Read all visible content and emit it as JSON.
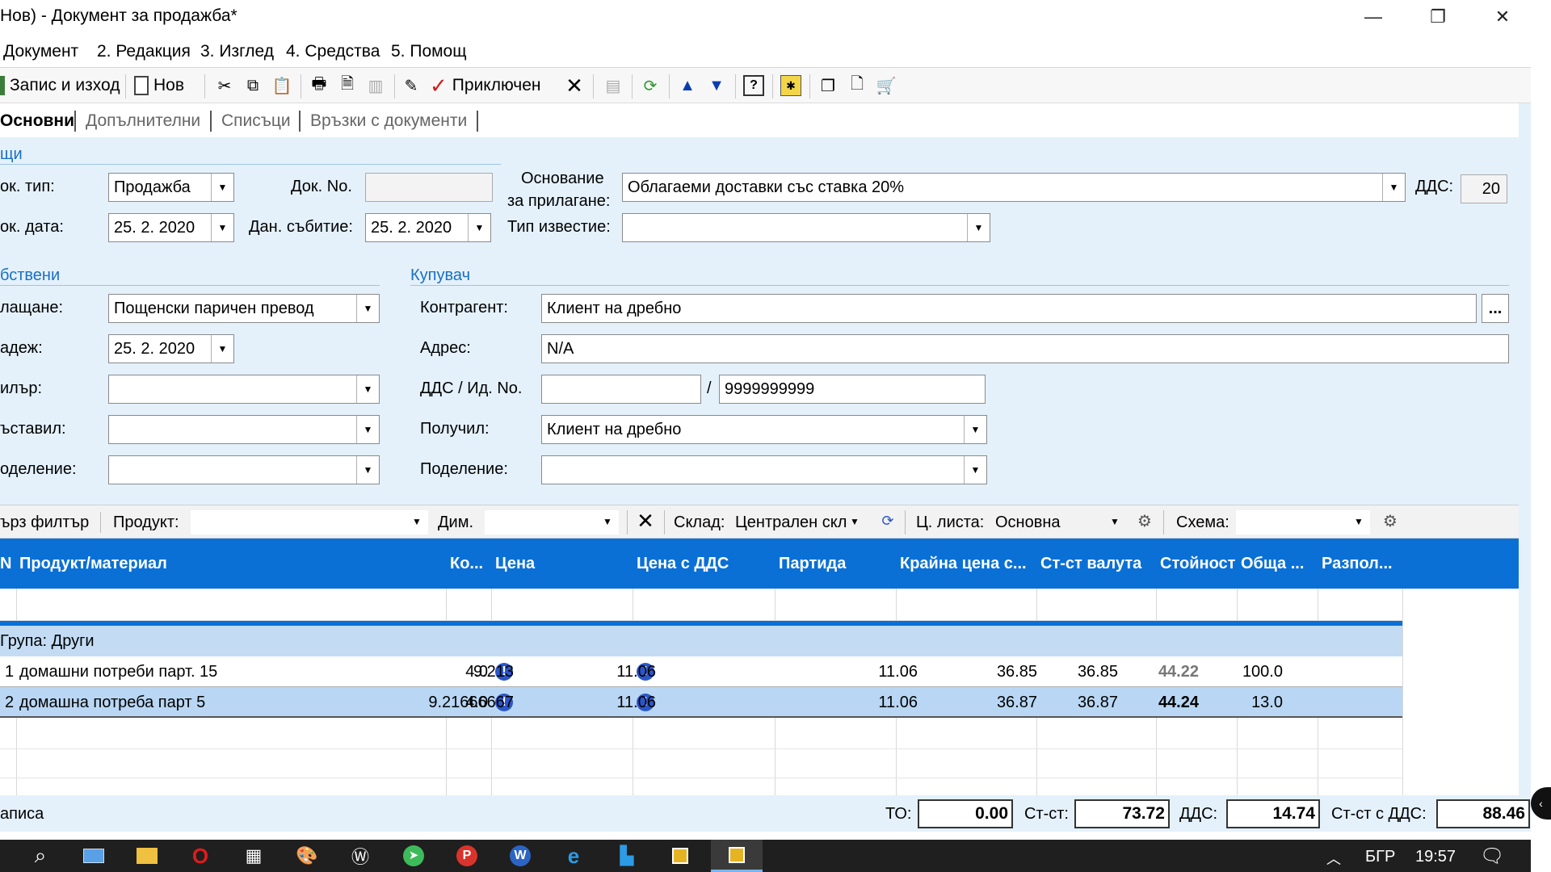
{
  "window": {
    "title": "Нов) - Документ за продажба*",
    "controls": {
      "minimize": "—",
      "restore": "❐",
      "close": "✕"
    }
  },
  "menu": [
    {
      "label": "Документ"
    },
    {
      "label": "2. Редакция"
    },
    {
      "label": "3. Изглед"
    },
    {
      "label": "4. Средства"
    },
    {
      "label": "5. Помощ"
    }
  ],
  "toolbar": {
    "save_exit": "Запис и изход",
    "new": "Нов",
    "completed": "Приключен"
  },
  "tabs": [
    {
      "label": "Основни",
      "active": true
    },
    {
      "label": "Допълнителни"
    },
    {
      "label": "Списъци"
    },
    {
      "label": "Връзки с документи"
    }
  ],
  "general": {
    "section": "щи",
    "doc_type_label": "ок. тип:",
    "doc_type": "Продажба",
    "doc_no_label": "Док. No.",
    "doc_no": "",
    "basis_label_1": "Основание",
    "basis_label_2": "за прилагане:",
    "basis": "Облагаеми доставки със ставка 20%",
    "vat_label": "ДДС:",
    "vat": "20",
    "doc_date_label": "ок. дата:",
    "doc_date": "25.  2. 2020",
    "tax_event_label": "Дан. събитие:",
    "tax_event": "25.  2. 2020",
    "notice_type_label": "Тип известие:",
    "notice_type": ""
  },
  "own": {
    "section": "бствени",
    "payment_label": "лащане:",
    "payment": "Пощенски паричен превод",
    "due_label": "адеж:",
    "due": "25.  2. 2020",
    "dealer_label": "илър:",
    "dealer": "",
    "issued_label": "ъставил:",
    "issued": "",
    "division_label": "оделение:",
    "division": ""
  },
  "buyer": {
    "section": "Купувач",
    "contractor_label": "Контрагент:",
    "contractor": "Клиент на дребно",
    "browse": "...",
    "address_label": "Адрес:",
    "address": "N/A",
    "vat_id_label": "ДДС / Ид. No.",
    "vat_no": "",
    "slash": "/",
    "id_no": "9999999999",
    "received_label": "Получил:",
    "received": "Клиент на дребно",
    "division_label": "Поделение:",
    "division": ""
  },
  "filter": {
    "quick": "ърз филтър",
    "product_label": "Продукт:",
    "product": "",
    "dim_label": "Дим.",
    "dim": "",
    "warehouse_label": "Склад:",
    "warehouse": "Централен скл",
    "pricelist_label": "Ц. листа:",
    "pricelist": "Основна",
    "scheme_label": "Схема:",
    "scheme": ""
  },
  "grid": {
    "columns": [
      "N",
      "Продукт/материал",
      "Ко...",
      "Цена",
      "Цена с ДДС",
      "Партида",
      "Крайна цена с...",
      "Ст-ст валута",
      "Стойност",
      "Обща ...",
      "Разпол..."
    ],
    "group": "Група: Други",
    "rows": [
      {
        "n": "1",
        "product": "домашни потреби парт. 15",
        "qty": "4.0",
        "price": "9.213",
        "price_vat": "11.06",
        "batch": "",
        "final_price": "11.06",
        "value_cur": "36.85",
        "value": "36.85",
        "total": "44.22",
        "avail": "100.0"
      },
      {
        "n": "2",
        "product": "домашна потреба парт 5",
        "qty": "4.0",
        "price": "9.21666667",
        "price_vat": "11.06",
        "batch": "",
        "final_price": "11.06",
        "value_cur": "36.87",
        "value": "36.87",
        "total": "44.24",
        "avail": "13.0"
      }
    ]
  },
  "status": {
    "records": "аписа",
    "to_label": "ТО:",
    "to": "0.00",
    "value_label": "Ст-ст:",
    "value": "73.72",
    "vat_label": "ДДС:",
    "vat": "14.74",
    "total_label": "Ст-ст с ДДС:",
    "total": "88.46"
  },
  "taskbar": {
    "lang": "БГР",
    "time": "19:57"
  },
  "colors": {
    "window_bg": "#e4f1fb",
    "header_blue": "#0a70d6",
    "selected_row": "#b9d7f4",
    "group_row": "#c3dcf4"
  }
}
